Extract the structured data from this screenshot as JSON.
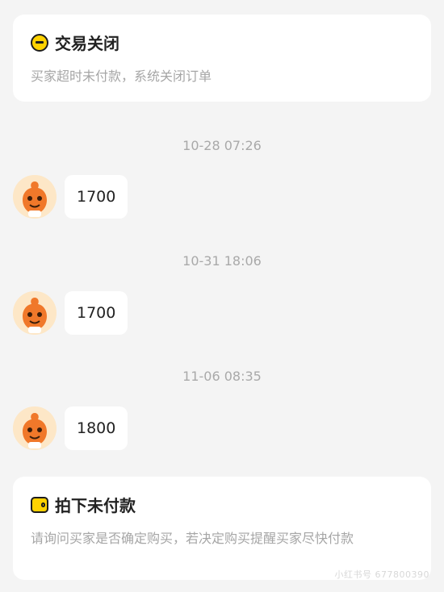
{
  "top_card": {
    "title": "交易关闭",
    "description": "买家超时未付款，系统关闭订单",
    "icon": "minus-circle-icon"
  },
  "messages": [
    {
      "timestamp": "10-28 07:26",
      "text": "1700"
    },
    {
      "timestamp": "10-31 18:06",
      "text": "1700"
    },
    {
      "timestamp": "11-06 08:35",
      "text": "1800"
    }
  ],
  "bottom_card": {
    "title": "拍下未付款",
    "description": "请询问买家是否确定购买，若决定购买提醒买家尽快付款",
    "icon": "wallet-icon"
  },
  "watermark": "小红书号 677800390",
  "colors": {
    "background": "#f4f4f4",
    "card": "#ffffff",
    "accent_yellow": "#ffd200",
    "avatar_orange": "#f0782a"
  }
}
